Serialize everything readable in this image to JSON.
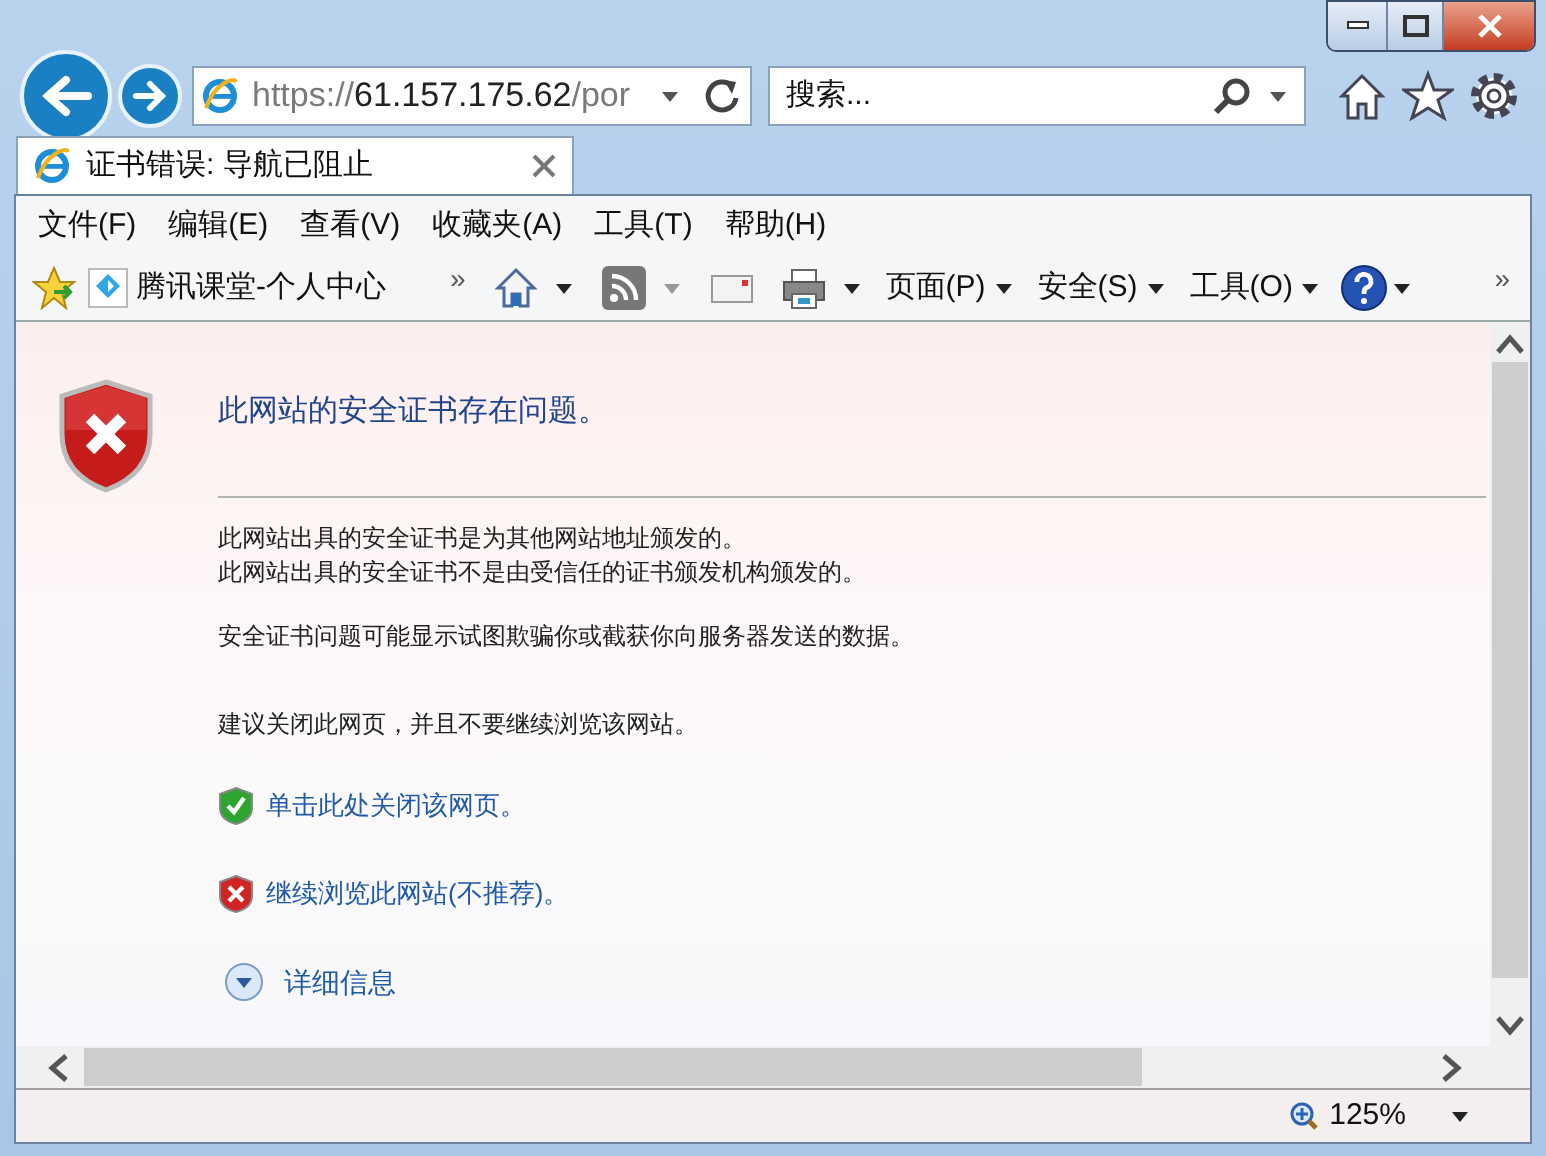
{
  "address_bar": {
    "scheme": "https://",
    "host": "61.157.175.62",
    "path": "/por"
  },
  "search": {
    "placeholder": "搜索..."
  },
  "tab": {
    "title": "证书错误: 导航已阻止"
  },
  "menu": [
    "文件(F)",
    "编辑(E)",
    "查看(V)",
    "收藏夹(A)",
    "工具(T)",
    "帮助(H)"
  ],
  "favorites": {
    "items": [
      {
        "label": "腾讯课堂-个人中心"
      }
    ],
    "overflow": "»"
  },
  "command_bar": {
    "items": [
      {
        "kind": "home"
      },
      {
        "kind": "feeds"
      },
      {
        "kind": "mail"
      },
      {
        "kind": "print"
      },
      {
        "kind": "menu",
        "label": "页面(P)"
      },
      {
        "kind": "menu",
        "label": "安全(S)"
      },
      {
        "kind": "menu",
        "label": "工具(O)"
      },
      {
        "kind": "help"
      }
    ],
    "overflow": "»"
  },
  "content": {
    "heading": "此网站的安全证书存在问题。",
    "paragraphs": [
      [
        "此网站出具的安全证书是为其他网站地址颁发的。",
        "此网站出具的安全证书不是由受信任的证书颁发机构颁发的。"
      ],
      [
        "安全证书问题可能显示试图欺骗你或截获你向服务器发送的数据。"
      ]
    ],
    "recommendation": "建议关闭此网页，并且不要继续浏览该网站。",
    "links": [
      {
        "kind": "safe",
        "text": "单击此处关闭该网页。"
      },
      {
        "kind": "unsafe",
        "text": "继续浏览此网站(不推荐)。"
      }
    ],
    "details": "详细信息"
  },
  "status_bar": {
    "zoom": "125%"
  }
}
